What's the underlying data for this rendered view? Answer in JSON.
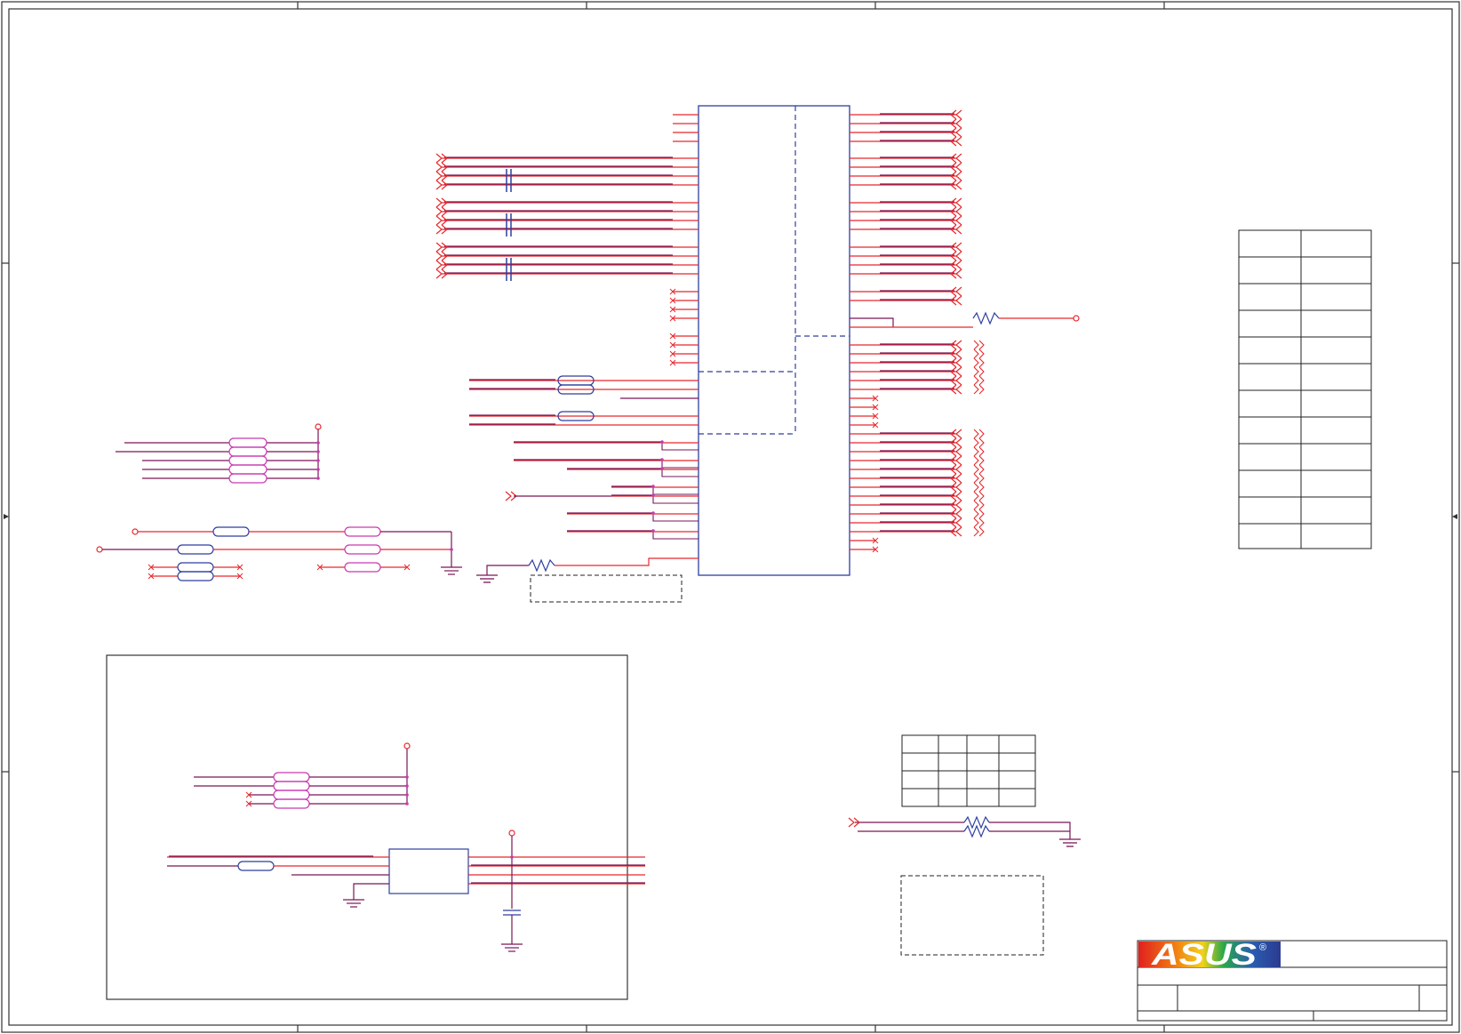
{
  "logo": {
    "text": "ASUS",
    "registered": "®"
  },
  "colors": {
    "wire": "#e8282c",
    "net": "#7a1656",
    "component": "#2e3f9e",
    "alt_component": "#c83ab0",
    "frame": "#333333"
  }
}
